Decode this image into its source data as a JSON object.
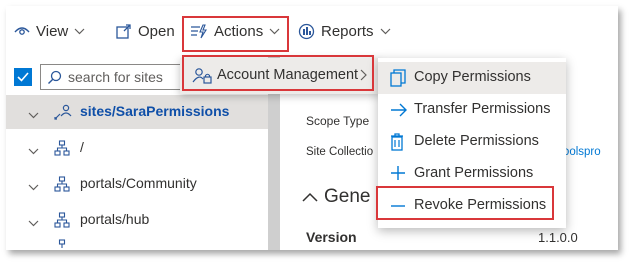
{
  "toolbar": {
    "view_label": "View",
    "open_label": "Open",
    "actions_label": "Actions",
    "reports_label": "Reports"
  },
  "sidebar": {
    "search_placeholder": "search for sites",
    "items": [
      {
        "label": "sites/SaraPermissions",
        "icon": "site-collection-icon",
        "selected": true
      },
      {
        "label": "/",
        "icon": "site-tree-icon"
      },
      {
        "label": "portals/Community",
        "icon": "site-tree-icon"
      },
      {
        "label": "portals/hub",
        "icon": "site-tree-icon"
      }
    ]
  },
  "actions_menu": {
    "items": [
      {
        "label": "Account Management",
        "icon": "user-lock-icon"
      }
    ]
  },
  "account_submenu": {
    "items": [
      {
        "label": "Copy Permissions",
        "icon": "copy-icon"
      },
      {
        "label": "Transfer Permissions",
        "icon": "arrow-right-icon"
      },
      {
        "label": "Delete Permissions",
        "icon": "trash-icon"
      },
      {
        "label": "Grant Permissions",
        "icon": "plus-icon"
      },
      {
        "label": "Revoke Permissions",
        "icon": "minus-icon"
      }
    ]
  },
  "details": {
    "scope_type_label": "Scope Type",
    "site_collection_label": "Site Collectio",
    "general_heading": "Gene",
    "version_label": "Version",
    "version_value": "1.1.0.0",
    "url_fragment": "ningtoolspro"
  },
  "colors": {
    "accent": "#0078d4",
    "highlight_border": "#d9373a",
    "selected_bg": "#e1dfdd"
  }
}
